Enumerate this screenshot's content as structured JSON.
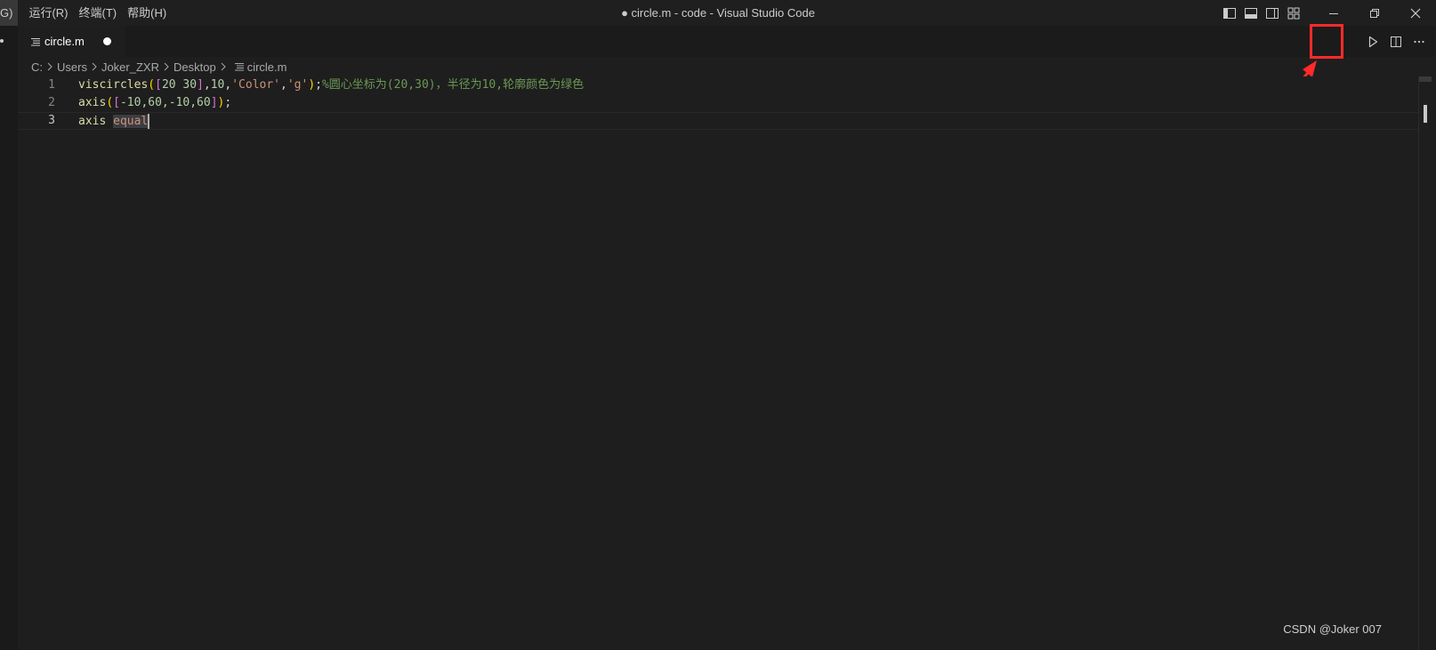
{
  "menu": {
    "truncated_item": "G)",
    "items": [
      "运行(R)",
      "终端(T)",
      "帮助(H)"
    ]
  },
  "window_title": "● circle.m - code - Visual Studio Code",
  "tab": {
    "label": "circle.m",
    "dirty": true
  },
  "breadcrumb": [
    "C:",
    "Users",
    "Joker_ZXR",
    "Desktop",
    "circle.m"
  ],
  "editor": {
    "line_numbers": [
      "1",
      "2",
      "3"
    ],
    "lines": [
      {
        "fn": "viscircles",
        "open1": "(",
        "open2": "[",
        "nums": "20 30",
        "close2": "]",
        "sep1": ",",
        "radius": "10",
        "sep2": ",",
        "str1": "'Color'",
        "sep3": ",",
        "str2": "'g'",
        "close1": ")",
        "semi": ";",
        "comment": "%圆心坐标为(20,30)，半径为10,轮廓颜色为绿色"
      },
      {
        "fn": "axis",
        "open1": "(",
        "open2": "[",
        "vals": "-10,60,-10,60",
        "close2": "]",
        "close1": ")",
        "semi": ";"
      },
      {
        "cmd": "axis",
        "arg": "equal"
      }
    ]
  },
  "watermark": "CSDN @Joker 007",
  "colors": {
    "annotation_red": "#ff2a2a"
  }
}
